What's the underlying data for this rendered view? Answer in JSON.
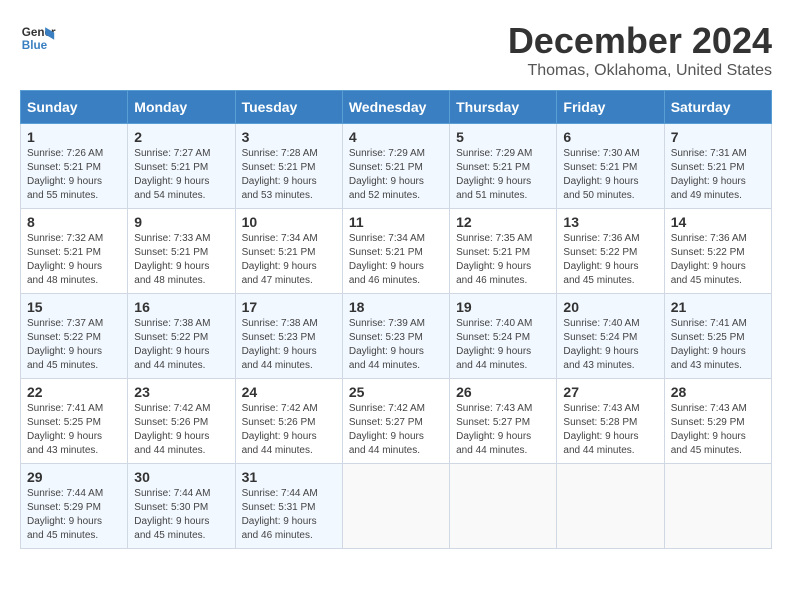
{
  "logo": {
    "line1": "General",
    "line2": "Blue"
  },
  "title": "December 2024",
  "location": "Thomas, Oklahoma, United States",
  "days_of_week": [
    "Sunday",
    "Monday",
    "Tuesday",
    "Wednesday",
    "Thursday",
    "Friday",
    "Saturday"
  ],
  "weeks": [
    [
      {
        "day": 1,
        "sunrise": "7:26 AM",
        "sunset": "5:21 PM",
        "daylight": "9 hours and 55 minutes."
      },
      {
        "day": 2,
        "sunrise": "7:27 AM",
        "sunset": "5:21 PM",
        "daylight": "9 hours and 54 minutes."
      },
      {
        "day": 3,
        "sunrise": "7:28 AM",
        "sunset": "5:21 PM",
        "daylight": "9 hours and 53 minutes."
      },
      {
        "day": 4,
        "sunrise": "7:29 AM",
        "sunset": "5:21 PM",
        "daylight": "9 hours and 52 minutes."
      },
      {
        "day": 5,
        "sunrise": "7:29 AM",
        "sunset": "5:21 PM",
        "daylight": "9 hours and 51 minutes."
      },
      {
        "day": 6,
        "sunrise": "7:30 AM",
        "sunset": "5:21 PM",
        "daylight": "9 hours and 50 minutes."
      },
      {
        "day": 7,
        "sunrise": "7:31 AM",
        "sunset": "5:21 PM",
        "daylight": "9 hours and 49 minutes."
      }
    ],
    [
      {
        "day": 8,
        "sunrise": "7:32 AM",
        "sunset": "5:21 PM",
        "daylight": "9 hours and 48 minutes."
      },
      {
        "day": 9,
        "sunrise": "7:33 AM",
        "sunset": "5:21 PM",
        "daylight": "9 hours and 48 minutes."
      },
      {
        "day": 10,
        "sunrise": "7:34 AM",
        "sunset": "5:21 PM",
        "daylight": "9 hours and 47 minutes."
      },
      {
        "day": 11,
        "sunrise": "7:34 AM",
        "sunset": "5:21 PM",
        "daylight": "9 hours and 46 minutes."
      },
      {
        "day": 12,
        "sunrise": "7:35 AM",
        "sunset": "5:21 PM",
        "daylight": "9 hours and 46 minutes."
      },
      {
        "day": 13,
        "sunrise": "7:36 AM",
        "sunset": "5:22 PM",
        "daylight": "9 hours and 45 minutes."
      },
      {
        "day": 14,
        "sunrise": "7:36 AM",
        "sunset": "5:22 PM",
        "daylight": "9 hours and 45 minutes."
      }
    ],
    [
      {
        "day": 15,
        "sunrise": "7:37 AM",
        "sunset": "5:22 PM",
        "daylight": "9 hours and 45 minutes."
      },
      {
        "day": 16,
        "sunrise": "7:38 AM",
        "sunset": "5:22 PM",
        "daylight": "9 hours and 44 minutes."
      },
      {
        "day": 17,
        "sunrise": "7:38 AM",
        "sunset": "5:23 PM",
        "daylight": "9 hours and 44 minutes."
      },
      {
        "day": 18,
        "sunrise": "7:39 AM",
        "sunset": "5:23 PM",
        "daylight": "9 hours and 44 minutes."
      },
      {
        "day": 19,
        "sunrise": "7:40 AM",
        "sunset": "5:24 PM",
        "daylight": "9 hours and 44 minutes."
      },
      {
        "day": 20,
        "sunrise": "7:40 AM",
        "sunset": "5:24 PM",
        "daylight": "9 hours and 43 minutes."
      },
      {
        "day": 21,
        "sunrise": "7:41 AM",
        "sunset": "5:25 PM",
        "daylight": "9 hours and 43 minutes."
      }
    ],
    [
      {
        "day": 22,
        "sunrise": "7:41 AM",
        "sunset": "5:25 PM",
        "daylight": "9 hours and 43 minutes."
      },
      {
        "day": 23,
        "sunrise": "7:42 AM",
        "sunset": "5:26 PM",
        "daylight": "9 hours and 44 minutes."
      },
      {
        "day": 24,
        "sunrise": "7:42 AM",
        "sunset": "5:26 PM",
        "daylight": "9 hours and 44 minutes."
      },
      {
        "day": 25,
        "sunrise": "7:42 AM",
        "sunset": "5:27 PM",
        "daylight": "9 hours and 44 minutes."
      },
      {
        "day": 26,
        "sunrise": "7:43 AM",
        "sunset": "5:27 PM",
        "daylight": "9 hours and 44 minutes."
      },
      {
        "day": 27,
        "sunrise": "7:43 AM",
        "sunset": "5:28 PM",
        "daylight": "9 hours and 44 minutes."
      },
      {
        "day": 28,
        "sunrise": "7:43 AM",
        "sunset": "5:29 PM",
        "daylight": "9 hours and 45 minutes."
      }
    ],
    [
      {
        "day": 29,
        "sunrise": "7:44 AM",
        "sunset": "5:29 PM",
        "daylight": "9 hours and 45 minutes."
      },
      {
        "day": 30,
        "sunrise": "7:44 AM",
        "sunset": "5:30 PM",
        "daylight": "9 hours and 45 minutes."
      },
      {
        "day": 31,
        "sunrise": "7:44 AM",
        "sunset": "5:31 PM",
        "daylight": "9 hours and 46 minutes."
      },
      null,
      null,
      null,
      null
    ]
  ]
}
